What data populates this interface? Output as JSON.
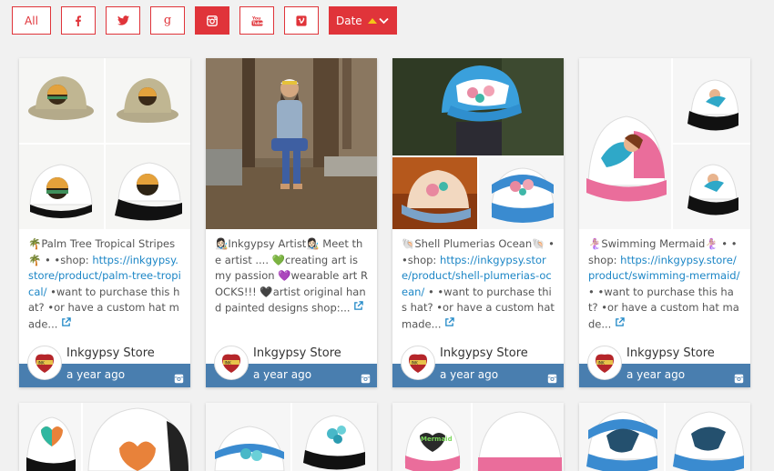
{
  "filters": {
    "all_label": "All",
    "facebook_icon": "facebook-icon",
    "twitter_icon": "twitter-icon",
    "google_icon": "google-plus-icon",
    "instagram_icon": "instagram-icon",
    "youtube_icon": "youtube-icon",
    "vimeo_icon": "vimeo-icon",
    "date_label": "Date",
    "accent": "#e0343a"
  },
  "cards": [
    {
      "text_prefix": "🌴Palm Tree Tropical Stripes🌴 • •shop: ",
      "link": "https://inkgypsy.store/product/palm-tree-tropical/",
      "text_suffix": " •want to purchase this hat? •or have a custom hat made...",
      "author": "Inkgypsy Store",
      "time": "a year ago"
    },
    {
      "text_prefix": "👩🏻‍🎨Inkgypsy Artist👩🏻‍🎨 Meet the artist .... 💚creating art is my passion 💜wearable art ROCKS!!! 🖤artist original hand painted designs shop:...",
      "link": "",
      "text_suffix": "",
      "author": "Inkgypsy Store",
      "time": "a year ago"
    },
    {
      "text_prefix": "🐚Shell Plumerias Ocean🐚 • •shop: ",
      "link": "https://inkgypsy.store/product/shell-plumerias-ocean/",
      "text_suffix": " • •want to purchase this hat? •or have a custom hat made...",
      "author": "Inkgypsy Store",
      "time": "a year ago"
    },
    {
      "text_prefix": "🧜🏼‍♀️Swimming Mermaid🧜🏼‍♀️ • •shop: ",
      "link": "https://inkgypsy.store/product/swimming-mermaid/",
      "text_suffix": " • •want to purchase this hat? •or have a custom hat made...",
      "author": "Inkgypsy Store",
      "time": "a year ago"
    }
  ],
  "colors": {
    "footer": "#497eaf",
    "link": "#1c86c6",
    "accent": "#e0343a"
  }
}
